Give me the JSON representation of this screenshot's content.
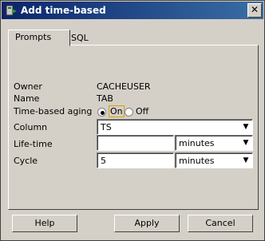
{
  "window": {
    "title": "Add time-based",
    "close_label": "✕"
  },
  "tabs": [
    {
      "label": "Prompts"
    },
    {
      "label": "SQL"
    }
  ],
  "form": {
    "owner_label": "Owner",
    "owner_value": "CACHEUSER",
    "name_label": "Name",
    "name_value": "TAB",
    "aging_label": "Time-based aging",
    "aging_on": "On",
    "aging_off": "Off",
    "column_label": "Column",
    "column_value": "TS",
    "lifetime_label": "Life-time",
    "lifetime_value": "",
    "lifetime_unit": "minutes",
    "cycle_label": "Cycle",
    "cycle_value": "5",
    "cycle_unit": "minutes"
  },
  "buttons": {
    "help": "Help",
    "apply": "Apply",
    "cancel": "Cancel"
  }
}
